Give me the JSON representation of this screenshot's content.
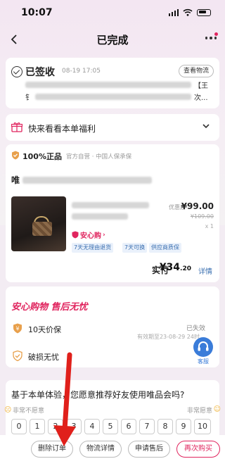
{
  "status_bar": {
    "time": "10:07"
  },
  "nav": {
    "title": "已完成"
  },
  "status_card": {
    "title": "已签收",
    "time": "08-19 17:05",
    "logistics_button": "查看物流",
    "address_frag_right": "【王",
    "address_frag_left2": "钅",
    "address_frag_right2": "次..."
  },
  "welfare": {
    "text": "快来看看本单福利"
  },
  "order": {
    "genuine": "100%正品",
    "genuine_sub": "官方自营 · 中国人保承保",
    "title_fragment": "唯",
    "price_label": "优惠后",
    "price": "¥99.00",
    "orig_price": "¥109.00",
    "qty": "x 1",
    "anxin": "安心购",
    "tags": [
      "7天无理由退货",
      "7天可换",
      "供应商质保"
    ],
    "paid_label": "实付",
    "paid_value": "¥34",
    "paid_decimal": ".20",
    "detail_link": "详情"
  },
  "assurance": {
    "title": "安心购物 售后无忧",
    "rows": [
      {
        "label": "10天价保"
      },
      {
        "label": "破损无忧"
      }
    ],
    "status": "已失效",
    "date": "有效期至23-08-29 24时",
    "kefu": "客服"
  },
  "survey": {
    "question": "基于本单体验，您愿意推荐好友使用唯品会吗?",
    "low": "非常不愿意",
    "high": "非常愿意",
    "numbers": [
      "0",
      "1",
      "2",
      "3",
      "4",
      "5",
      "6",
      "7",
      "8",
      "9",
      "10"
    ]
  },
  "bottom_bar": {
    "buttons": [
      "删除订单",
      "物流详情",
      "申请售后",
      "再次购买"
    ]
  },
  "colors": {
    "accent": "#e0245e",
    "link": "#3a6fb0",
    "annotation": "#e0201b"
  }
}
